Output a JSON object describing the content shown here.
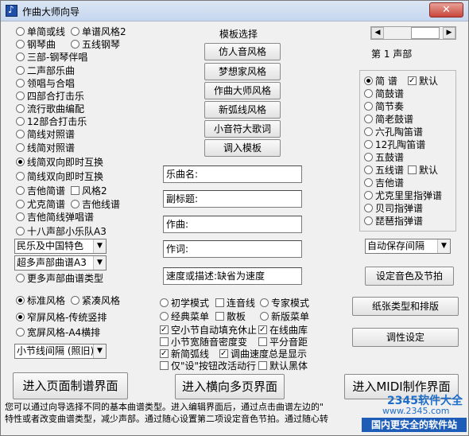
{
  "window": {
    "title": "作曲大师向导",
    "close_label": "✕"
  },
  "types": {
    "items": [
      {
        "label": "单简或线",
        "selected": false
      },
      {
        "label": "单谱风格2",
        "selected": false
      },
      {
        "label": "钢琴曲",
        "selected": false
      },
      {
        "label": "五线钢琴",
        "selected": false
      },
      {
        "label": "三部-钢琴伴唱",
        "selected": false
      },
      {
        "label": "二声部乐曲",
        "selected": false
      },
      {
        "label": "领唱与合唱",
        "selected": false
      },
      {
        "label": "四部合打击乐",
        "selected": false
      },
      {
        "label": "流行歌曲编配",
        "selected": false
      },
      {
        "label": "12部合打击乐",
        "selected": false
      },
      {
        "label": "简线对照谱",
        "selected": false
      },
      {
        "label": "线简对照谱",
        "selected": false
      },
      {
        "label": "线简双向即时互换",
        "selected": true
      },
      {
        "label": "简线双向即时互换",
        "selected": false
      },
      {
        "label": "吉他简谱",
        "selected": false
      },
      {
        "label": "尤克简谱",
        "selected": false
      },
      {
        "label": "吉他线谱",
        "selected": false
      },
      {
        "label": "吉他简线弹唱谱",
        "selected": false
      },
      {
        "label": "十八声部小乐队A3",
        "selected": false
      },
      {
        "label": "更多声部曲谱类型",
        "selected": false
      }
    ],
    "style2_check": "风格2",
    "select_style": "民乐及中国特色",
    "select_parts": "超多声部曲谱A3"
  },
  "layout_style": {
    "standard": "标准风格",
    "compact": "紧凑风格",
    "narrow": "窄屏风格-传统竖排",
    "wide": "宽屏风格-A4横排",
    "select_spacing": "小节线间隔 (照旧)"
  },
  "templates": {
    "heading": "模板选择",
    "buttons": [
      "仿人音风格",
      "梦想家风格",
      "作曲大师风格",
      "新弧线风格",
      "小音符大歌词",
      "调入模板"
    ]
  },
  "fields": {
    "title": "乐曲名:",
    "subtitle": "副标题:",
    "composer": "作曲:",
    "lyricist": "作词:",
    "tempo": "速度或描述:缺省为速度"
  },
  "modes": {
    "beginner": "初学模式",
    "ties": "连音线",
    "expert": "专家模式",
    "classic_menu": "经典菜单",
    "scattered": "散板",
    "new_menu": "新版菜单"
  },
  "options": {
    "auto_fill": "空小节自动填充休止",
    "online_lib": "在线曲库",
    "narrow_density": "小节宽随音密度变",
    "even_spacing": "平分音距",
    "new_arc": "新简弧线",
    "tempo_always": "调曲速度总是显示",
    "change_only": "仅\"设\"按钮改活动行",
    "default_bold": "默认黑体"
  },
  "right_panel": {
    "voice_label": "第 1 声部",
    "staff_items": [
      {
        "label": "简    谱",
        "selected": true
      },
      {
        "label": "简鼓谱",
        "selected": false
      },
      {
        "label": "简节奏",
        "selected": false
      },
      {
        "label": "简老鼓谱",
        "selected": false
      },
      {
        "label": "六孔陶笛谱",
        "selected": false
      },
      {
        "label": "12孔陶笛谱",
        "selected": false
      },
      {
        "label": "五鼓谱",
        "selected": false
      },
      {
        "label": "五线谱",
        "selected": false
      },
      {
        "label": "吉他谱",
        "selected": false
      },
      {
        "label": "尤克里里指弹谱",
        "selected": false
      },
      {
        "label": "贝司指弹谱",
        "selected": false
      },
      {
        "label": "琵琶指弹谱",
        "selected": false
      }
    ],
    "default_label": "默认",
    "default_label2": "默认",
    "autosave": "自动保存间隔",
    "set_color": "设定音色及节拍",
    "paper": "纸张类型和排版",
    "tuning": "调性设定"
  },
  "bottom": {
    "page_mode": "进入页面制谱界面",
    "horizontal": "进入横向多页界面",
    "midi": "进入MIDI制作界面",
    "description": "您可以通过向导选择不同的基本曲谱类型。进入编辑界面后，通过点击曲谱左边的\"",
    "description2": "特性或者改变曲谱类型，减少声部。通过随心设置第二项设定音色节拍。通过随心转"
  },
  "watermark": {
    "logo": "2345软件大全",
    "site": "www.2345.com",
    "bar": "国内更安全的软件站"
  },
  "colors": {
    "accent": "#1d5db8",
    "window_bg": "#f0f0f0"
  }
}
